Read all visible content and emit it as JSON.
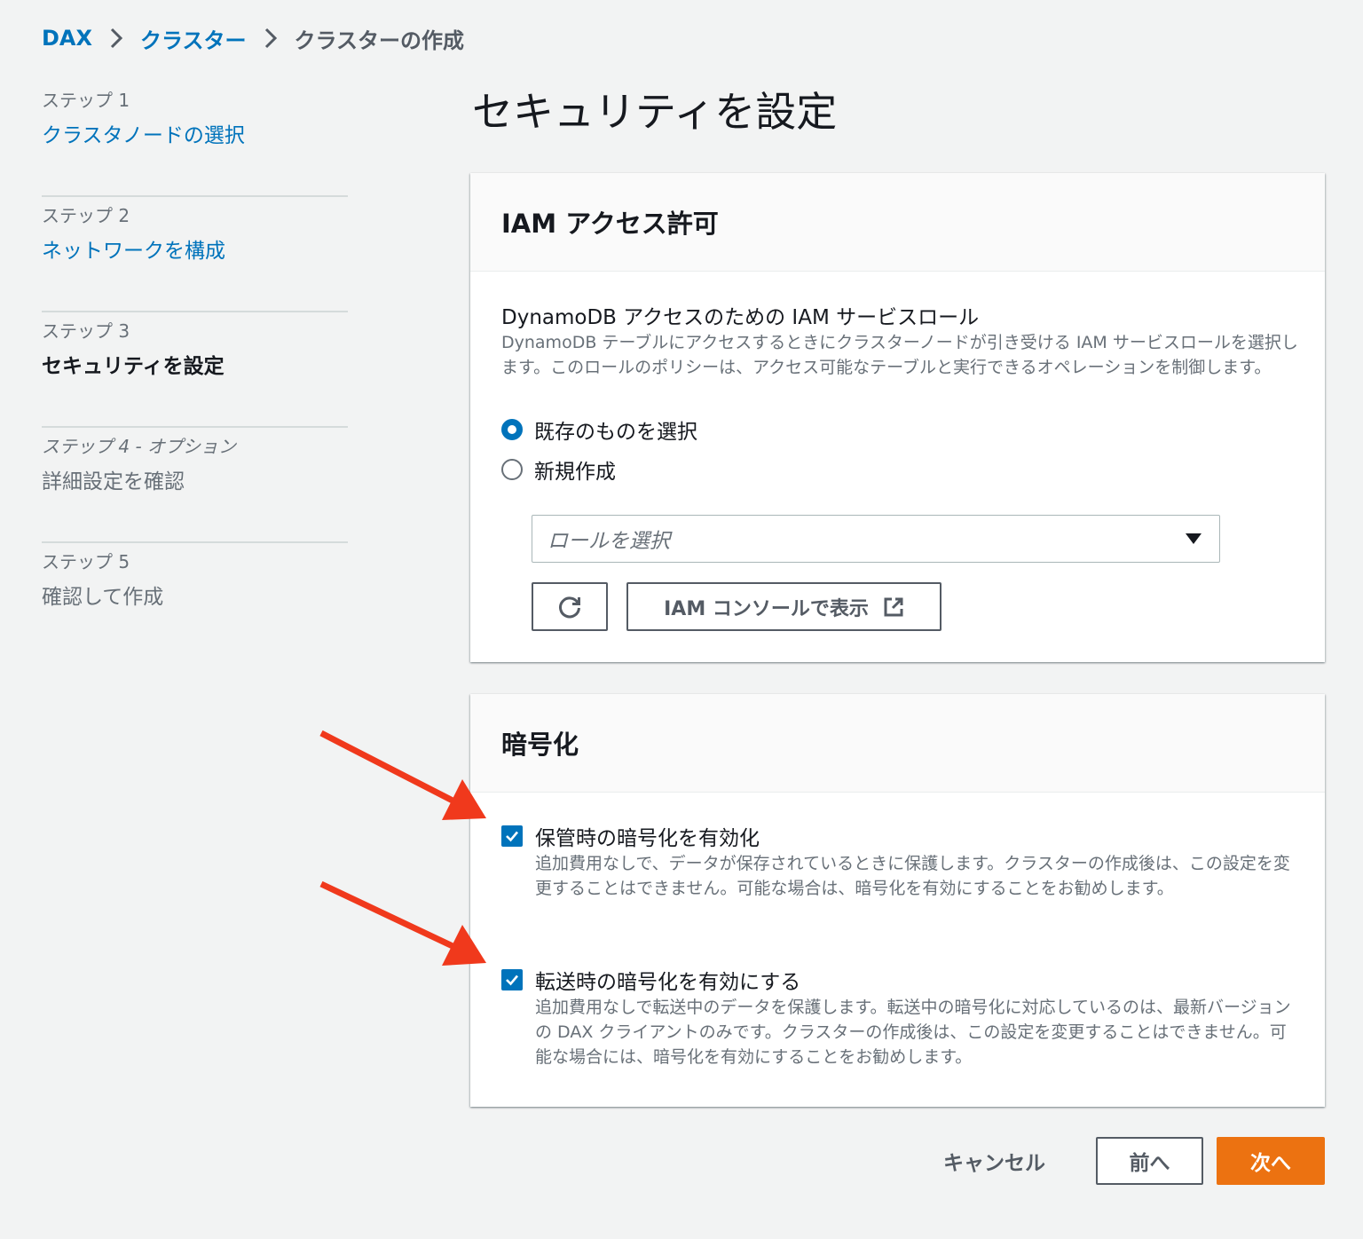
{
  "colors": {
    "background": "#f2f3f3",
    "link": "#0073bb",
    "text": "#16191f",
    "muted": "#687078",
    "primary_button": "#ec7211",
    "annotation_arrow": "#f0391c"
  },
  "breadcrumb": {
    "items": [
      "DAX",
      "クラスター",
      "クラスターの作成"
    ],
    "separator_icon": "chevron-right-icon"
  },
  "steps": [
    {
      "label": "ステップ 1",
      "title": "クラスタノードの選択",
      "state": "link"
    },
    {
      "label": "ステップ 2",
      "title": "ネットワークを構成",
      "state": "link"
    },
    {
      "label": "ステップ 3",
      "title": "セキュリティを設定",
      "state": "active"
    },
    {
      "label": "ステップ 4 - オプション",
      "title": "詳細設定を確認",
      "state": "disabled"
    },
    {
      "label": "ステップ 5",
      "title": "確認して作成",
      "state": "disabled"
    }
  ],
  "page_title": "セキュリティを設定",
  "iam": {
    "header": "IAM アクセス許可",
    "role_label": "DynamoDB アクセスのための IAM サービスロール",
    "role_description": "DynamoDB テーブルにアクセスするときにクラスターノードが引き受ける IAM サービスロールを選択します。このロールのポリシーは、アクセス可能なテーブルと実行できるオペレーションを制御します。",
    "options": [
      {
        "label": "既存のものを選択",
        "selected": true
      },
      {
        "label": "新規作成",
        "selected": false
      }
    ],
    "select_placeholder": "ロールを選択",
    "refresh_icon": "refresh-icon",
    "console_button": "IAM コンソールで表示",
    "console_button_icon": "external-link-icon"
  },
  "encryption": {
    "header": "暗号化",
    "at_rest": {
      "label": "保管時の暗号化を有効化",
      "checked": true,
      "description": "追加費用なしで、データが保存されているときに保護します。クラスターの作成後は、この設定を変更することはできません。可能な場合は、暗号化を有効にすることをお勧めします。"
    },
    "in_transit": {
      "label": "転送時の暗号化を有効にする",
      "checked": true,
      "description": "追加費用なしで転送中のデータを保護します。転送中の暗号化に対応しているのは、最新バージョンの DAX クライアントのみです。クラスターの作成後は、この設定を変更することはできません。可能な場合には、暗号化を有効にすることをお勧めします。"
    }
  },
  "footer": {
    "cancel": "キャンセル",
    "previous": "前へ",
    "next": "次へ"
  }
}
